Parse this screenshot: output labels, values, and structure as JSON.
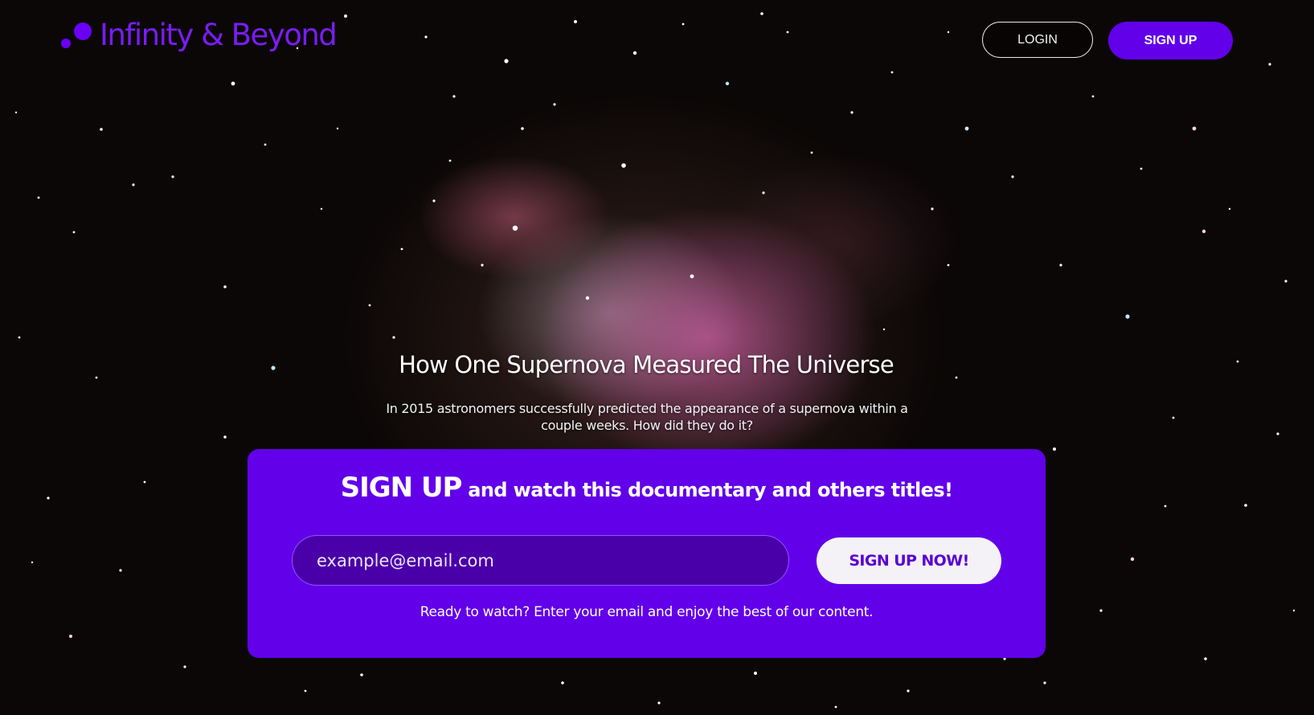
{
  "brand": {
    "name": "Infinity & Beyond",
    "logo_icon": "two-dots-logo-icon",
    "color": "#6a00f4"
  },
  "header": {
    "login_label": "LOGIN",
    "signup_label": "SIGN UP"
  },
  "hero": {
    "title": "How One Supernova Measured The Universe",
    "description": "In 2015 astronomers successfully predicted the appearance of a supernova within a couple weeks. How did they do it?",
    "background": "orion-nebula-image"
  },
  "signup_panel": {
    "headline_strong": "SIGN UP",
    "headline_rest": " and watch this documentary and others titles!",
    "email_placeholder": "example@email.com",
    "button_label": "SIGN UP NOW!",
    "note": "Ready to watch? Enter your email and enjoy the best of our content.",
    "panel_color": "#6200ea"
  }
}
